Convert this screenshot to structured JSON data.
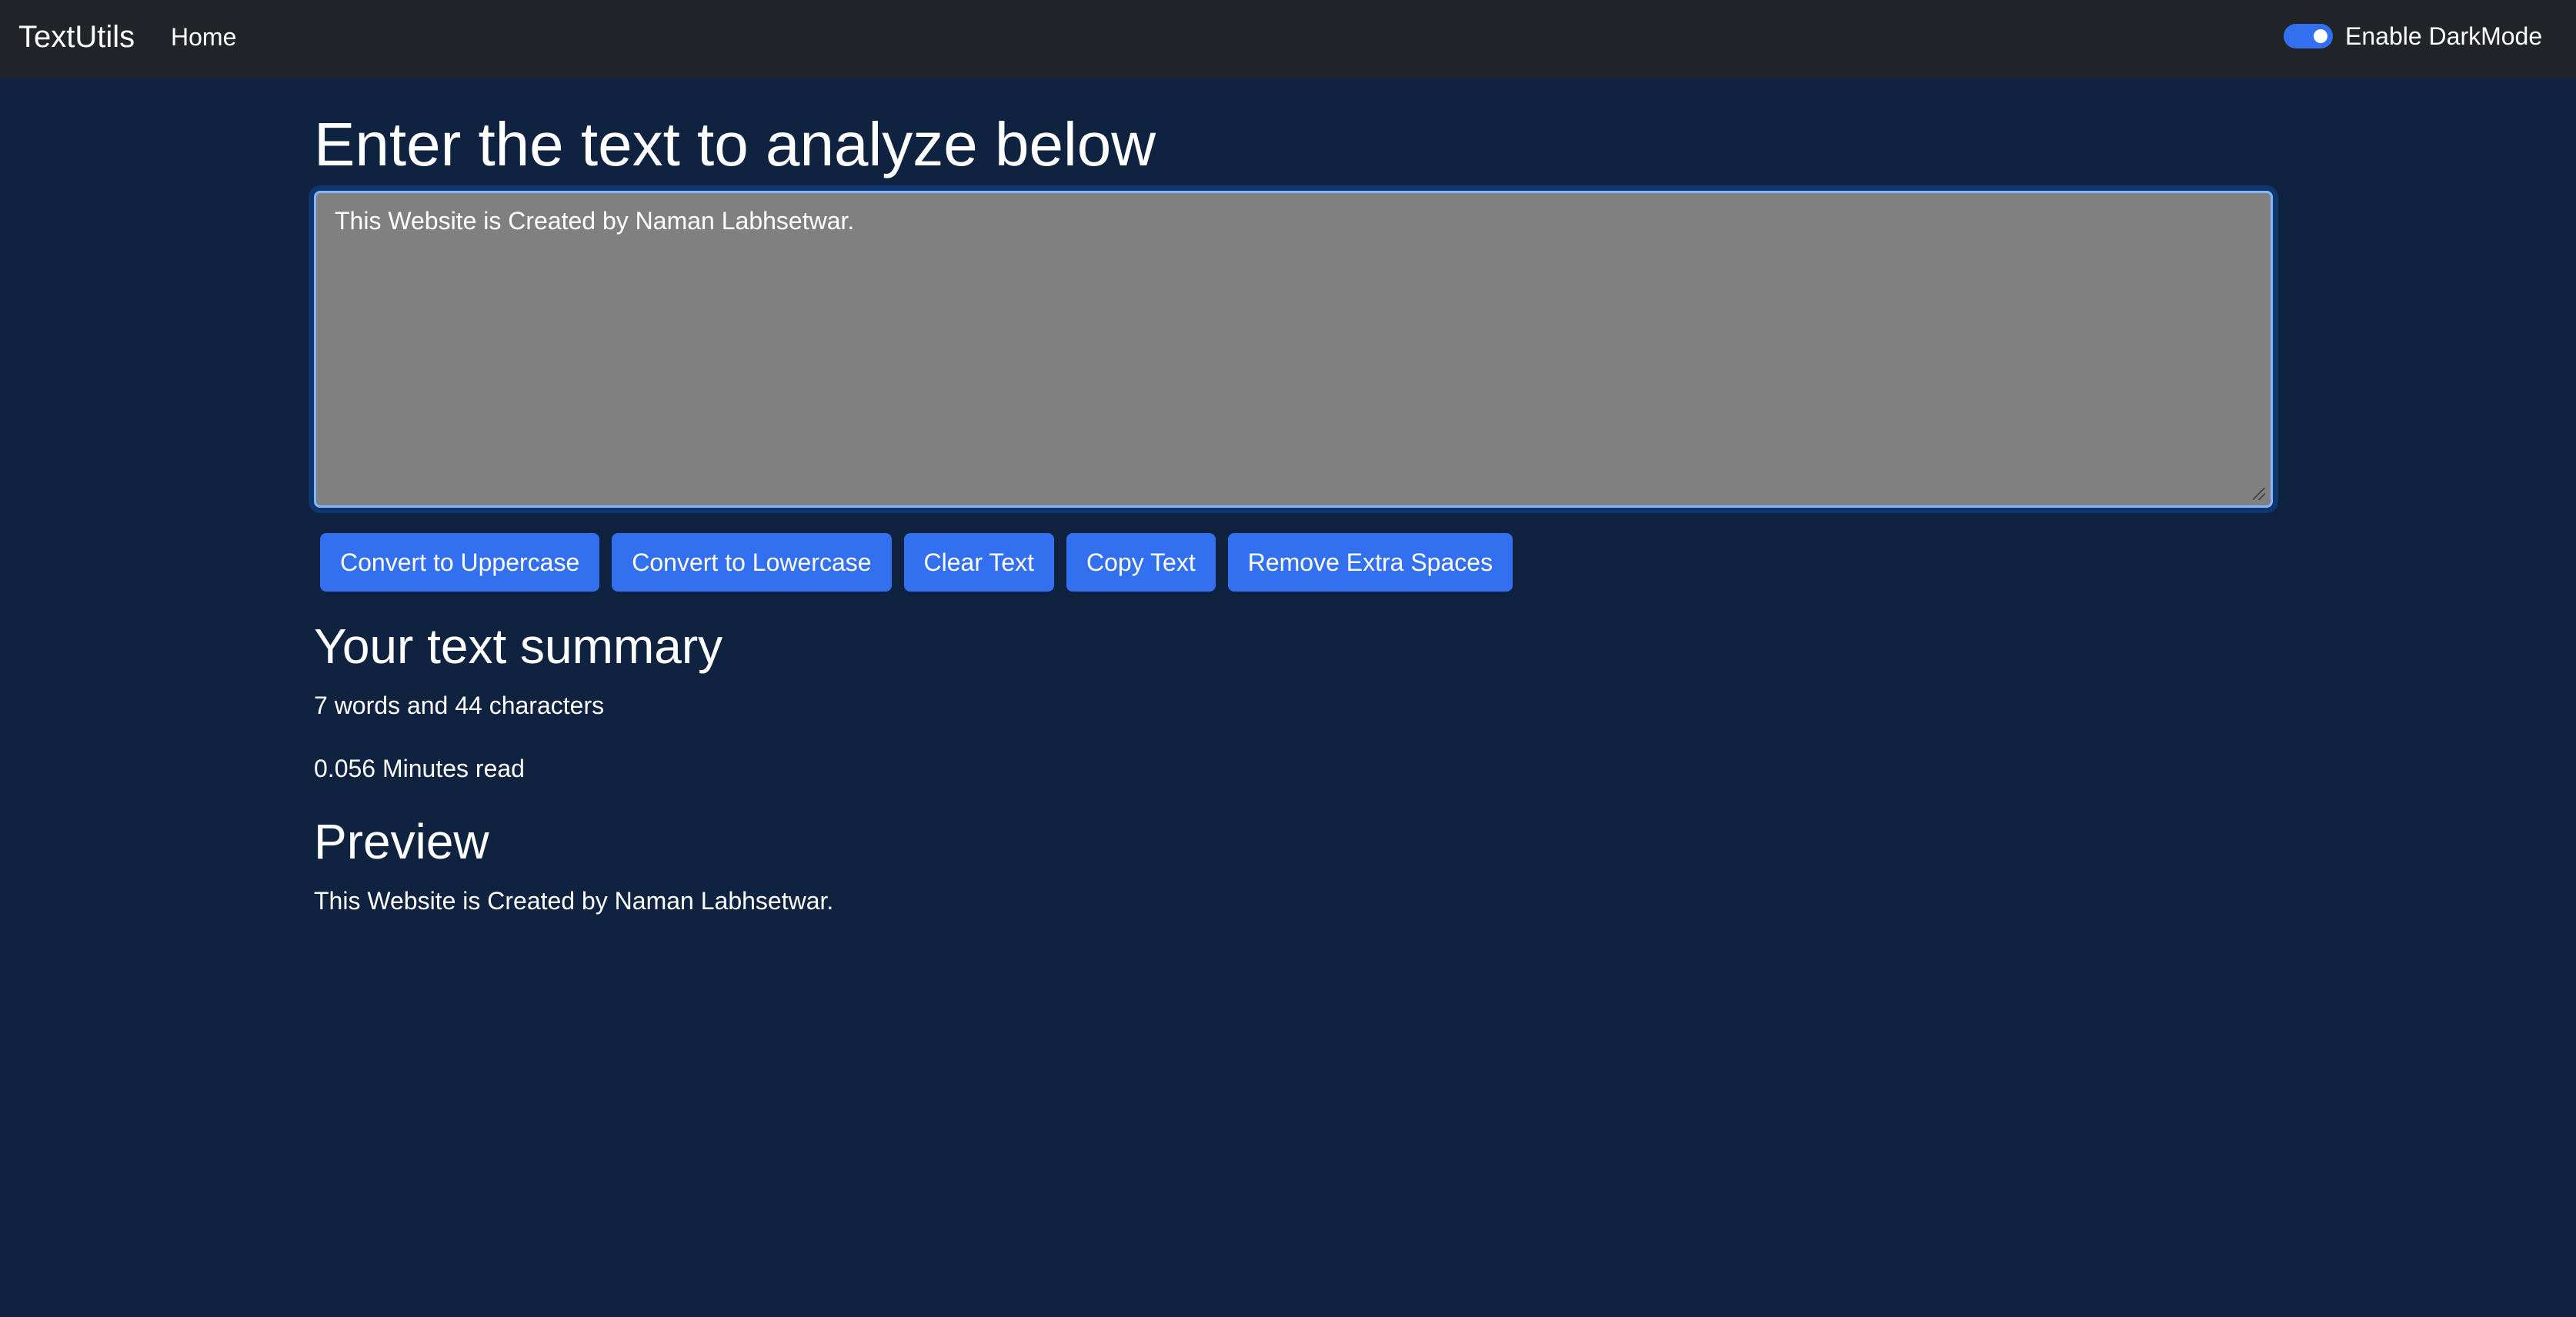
{
  "navbar": {
    "brand": "TextUtils",
    "links": [
      {
        "label": "Home"
      }
    ],
    "dark_mode_toggle": {
      "label": "Enable DarkMode",
      "checked": true
    }
  },
  "form": {
    "heading": "Enter the text to analyze below",
    "textarea_value": "This Website is Created by Naman Labhsetwar."
  },
  "buttons": [
    {
      "label": "Convert to Uppercase"
    },
    {
      "label": "Convert to Lowercase"
    },
    {
      "label": "Clear Text"
    },
    {
      "label": "Copy Text"
    },
    {
      "label": "Remove Extra Spaces"
    }
  ],
  "summary": {
    "heading": "Your text summary",
    "counts": "7 words and 44 characters",
    "read_time": "0.056 Minutes read"
  },
  "preview": {
    "heading": "Preview",
    "text": "This Website is Created by Naman Labhsetwar."
  },
  "colors": {
    "background": "#0f2340",
    "navbar": "#212529",
    "accent": "#3370ef",
    "textarea_bg": "#808080"
  }
}
